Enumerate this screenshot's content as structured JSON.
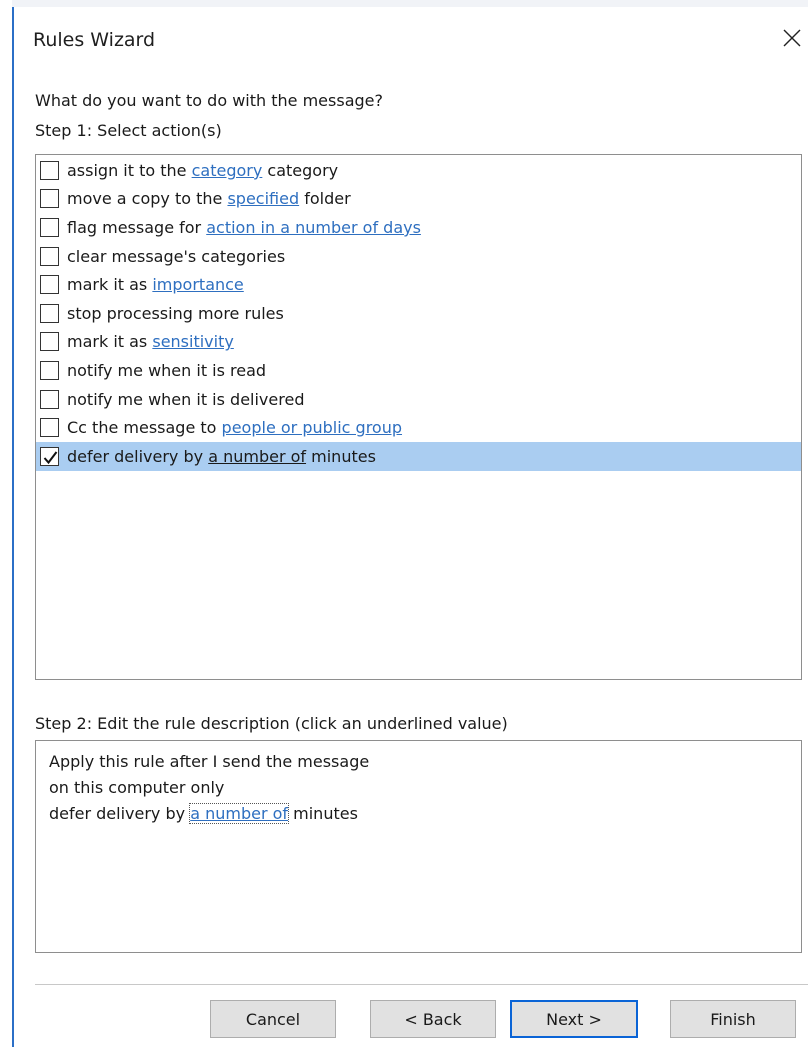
{
  "window": {
    "title": "Rules Wizard"
  },
  "step1": {
    "question": "What do you want to do with the message?",
    "label": "Step 1: Select action(s)",
    "actions": [
      {
        "before": "assign it to the",
        "link": "category",
        "after": "category",
        "checked": false
      },
      {
        "before": "move a copy to the",
        "link": "specified",
        "after": "folder",
        "checked": false
      },
      {
        "before": "flag message for",
        "link": "action in a number of days",
        "after": "",
        "checked": false
      },
      {
        "before": "clear message's categories",
        "link": "",
        "after": "",
        "checked": false
      },
      {
        "before": "mark it as",
        "link": "importance",
        "after": "",
        "checked": false
      },
      {
        "before": "stop processing more rules",
        "link": "",
        "after": "",
        "checked": false
      },
      {
        "before": "mark it as",
        "link": "sensitivity",
        "after": "",
        "checked": false
      },
      {
        "before": "notify me when it is read",
        "link": "",
        "after": "",
        "checked": false
      },
      {
        "before": "notify me when it is delivered",
        "link": "",
        "after": "",
        "checked": false
      },
      {
        "before": "Cc the message to",
        "link": "people or public group",
        "after": "",
        "checked": false
      },
      {
        "before": "defer delivery by",
        "link": "a number of",
        "after": "minutes",
        "checked": true,
        "selected": true
      }
    ]
  },
  "step2": {
    "label": "Step 2: Edit the rule description (click an underlined value)",
    "line1": "Apply this rule after I send the message",
    "line2": "on this computer only",
    "line3_before": "defer delivery by",
    "line3_link": "a number of",
    "line3_after": "minutes"
  },
  "buttons": {
    "cancel": "Cancel",
    "back": "< Back",
    "next": "Next >",
    "finish": "Finish"
  },
  "colors": {
    "selection": "#aacdf1",
    "link": "#2e6fc0",
    "default_button_border": "#0a64d6"
  }
}
